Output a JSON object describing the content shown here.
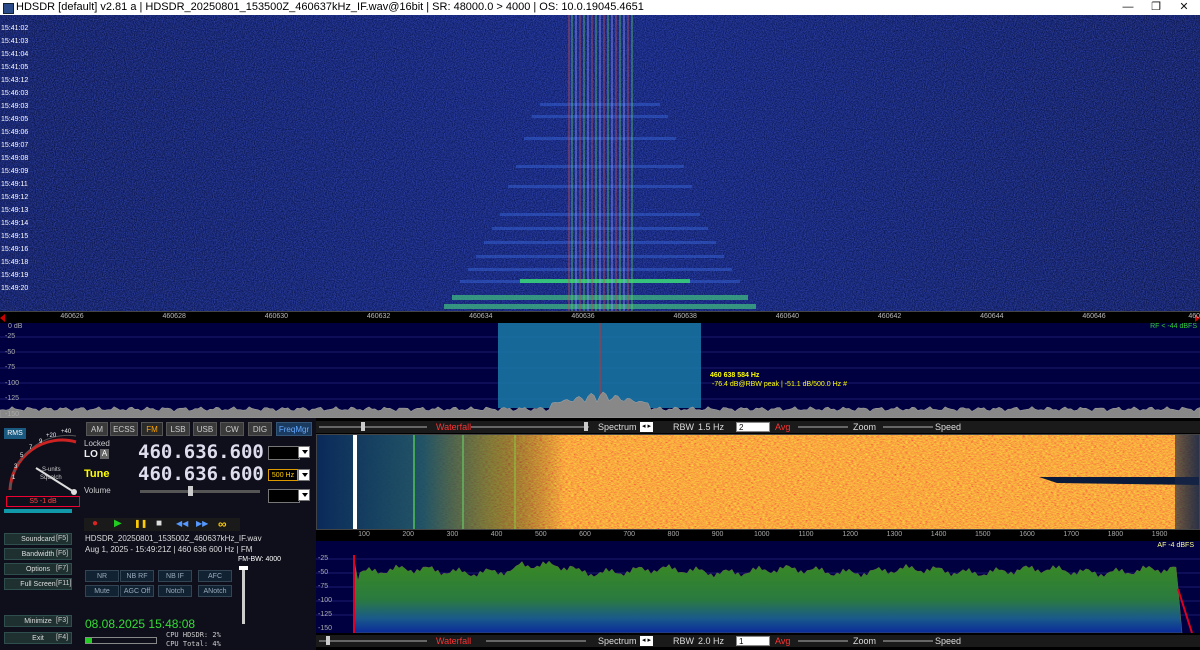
{
  "window": {
    "title": "HDSDR  [default]  v2.81 a  |  HDSDR_20250801_153500Z_460637kHz_IF.wav@16bit  |  SR: 48000.0 > 4000  |  OS: 10.0.19045.4651",
    "min_glyph": "—",
    "max_glyph": "❐",
    "close_glyph": "✕"
  },
  "rf_waterfall": {
    "timestamps": [
      "15:41:02",
      "15:41:03",
      "15:41:04",
      "15:41:05",
      "15:43:12",
      "15:46:03",
      "15:49:03",
      "15:49:05",
      "15:49:06",
      "15:49:07",
      "15:49:08",
      "15:49:09",
      "15:49:11",
      "15:49:12",
      "15:49:13",
      "15:49:14",
      "15:49:15",
      "15:49:16",
      "15:49:18",
      "15:49:19",
      "15:49:20"
    ],
    "freq_ticks": [
      "460626",
      "460628",
      "460630",
      "460632",
      "460634",
      "460636",
      "460638",
      "460640",
      "460642",
      "460644",
      "460646",
      "4606"
    ]
  },
  "rf_spectrum": {
    "y_labels": [
      "0 dB",
      "-25",
      "-50",
      "-75",
      "-100",
      "-125",
      "-150"
    ],
    "rf_level": "RF < -44 dBFS",
    "cursor_freq": "460 638 584 Hz",
    "cursor_info": "-76.4 dB@RBW peak | -51.1 dB/500.0 Hz #"
  },
  "smeter": {
    "rms_label": "RMS",
    "scale": [
      "1",
      "3",
      "5",
      "7",
      "9",
      "+20",
      "+40"
    ],
    "units_label": "S-units",
    "squelch_label": "Squelch",
    "reading": "S5 -1 dB"
  },
  "modes": [
    {
      "label": "AM",
      "active": false
    },
    {
      "label": "ECSS",
      "active": false
    },
    {
      "label": "FM",
      "active": true
    },
    {
      "label": "LSB",
      "active": false
    },
    {
      "label": "USB",
      "active": false
    },
    {
      "label": "CW",
      "active": false
    },
    {
      "label": "DIG",
      "active": false
    }
  ],
  "freqmgr_label": "FreqMgr",
  "lo": {
    "locked_label": "Locked",
    "label": "LO",
    "badge": "A",
    "freq": "460.636.600"
  },
  "tune": {
    "label": "Tune",
    "freq": "460.636.600",
    "step": "500 Hz"
  },
  "volume_label": "Volume",
  "file_info": {
    "name": "HDSDR_20250801_153500Z_460637kHz_IF.wav",
    "meta": "Aug 1, 2025 - 15:49:21Z | 460 636 600 Hz | FM"
  },
  "transport": [
    "●",
    "▶",
    "❚❚",
    "■",
    "◀◀",
    "▶▶",
    "∞"
  ],
  "side_buttons": [
    {
      "label": "Soundcard",
      "key": "[F5]"
    },
    {
      "label": "Bandwidth",
      "key": "[F6]"
    },
    {
      "label": "Options",
      "key": "[F7]"
    },
    {
      "label": "Full Screen",
      "key": "[F11]"
    },
    {
      "label": "Minimize",
      "key": "[F3]"
    },
    {
      "label": "Exit",
      "key": "[F4]"
    }
  ],
  "dsp_row1": [
    "NR",
    "NB RF",
    "NB IF",
    "AFC"
  ],
  "dsp_row2": [
    "Mute",
    "AGC Off",
    "Notch",
    "ANotch"
  ],
  "fm_bw": "FM-BW: 4000",
  "clock": "08.08.2025 15:48:08",
  "cpu": {
    "hdsdr": "CPU HDSDR:  2%",
    "total": "CPU Total:  4%"
  },
  "ctrl_bar_rf": {
    "waterfall": "Waterfall",
    "spectrum": "Spectrum",
    "rbw_label": "RBW",
    "rbw_value": "1.5 Hz",
    "avg_value": "2",
    "avg": "Avg",
    "zoom": "Zoom",
    "speed": "Speed"
  },
  "ctrl_bar_af": {
    "waterfall": "Waterfall",
    "spectrum": "Spectrum",
    "rbw_label": "RBW",
    "rbw_value": "2.0 Hz",
    "avg_value": "1",
    "avg": "Avg",
    "zoom": "Zoom",
    "speed": "Speed"
  },
  "af_waterfall": {
    "ticks": [
      "100",
      "200",
      "300",
      "400",
      "500",
      "600",
      "700",
      "800",
      "900",
      "1000",
      "1100",
      "1200",
      "1300",
      "1400",
      "1500",
      "1600",
      "1700",
      "1800",
      "1900"
    ]
  },
  "af_spectrum": {
    "y_labels": [
      "-25",
      "-50",
      "-75",
      "-100",
      "-125",
      "-150"
    ],
    "af_level": "AF -4 dBFS"
  },
  "colors": {
    "accent": "#ffa500",
    "highlight": "#ffff00",
    "brand_blue": "#1060a0",
    "green": "#00ff00"
  }
}
